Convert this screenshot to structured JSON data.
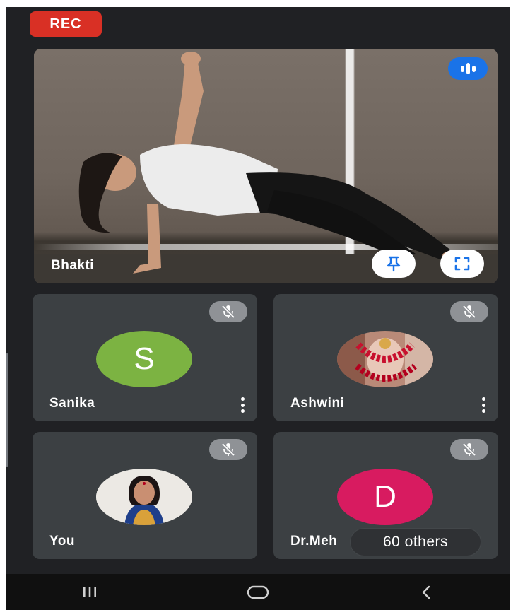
{
  "recording": {
    "label": "REC",
    "color": "#d93025"
  },
  "main_video": {
    "participant_name": "Bhakti",
    "speaking_indicator_icon": "audio-wave-icon",
    "pin_icon": "pin-icon",
    "fullscreen_icon": "fullscreen-icon"
  },
  "tiles": [
    {
      "name": "Sanika",
      "avatar_initial": "S",
      "avatar_color": "#7cb342",
      "mic_icon": "mic-off-icon",
      "menu_icon": "more-vert-icon"
    },
    {
      "name": "Ashwini",
      "avatar_photo": true,
      "mic_icon": "mic-off-icon",
      "menu_icon": "more-vert-icon"
    },
    {
      "name": "You",
      "avatar_photo": true,
      "mic_icon": "mic-off-icon"
    },
    {
      "name": "Dr.Meh",
      "avatar_initial": "D",
      "avatar_color": "#d81b60",
      "mic_icon": "mic-off-icon"
    }
  ],
  "others_pill": {
    "label": "60 others"
  },
  "system_nav": {
    "recents_icon": "recents-icon",
    "home_icon": "home-icon",
    "back_icon": "back-icon"
  }
}
